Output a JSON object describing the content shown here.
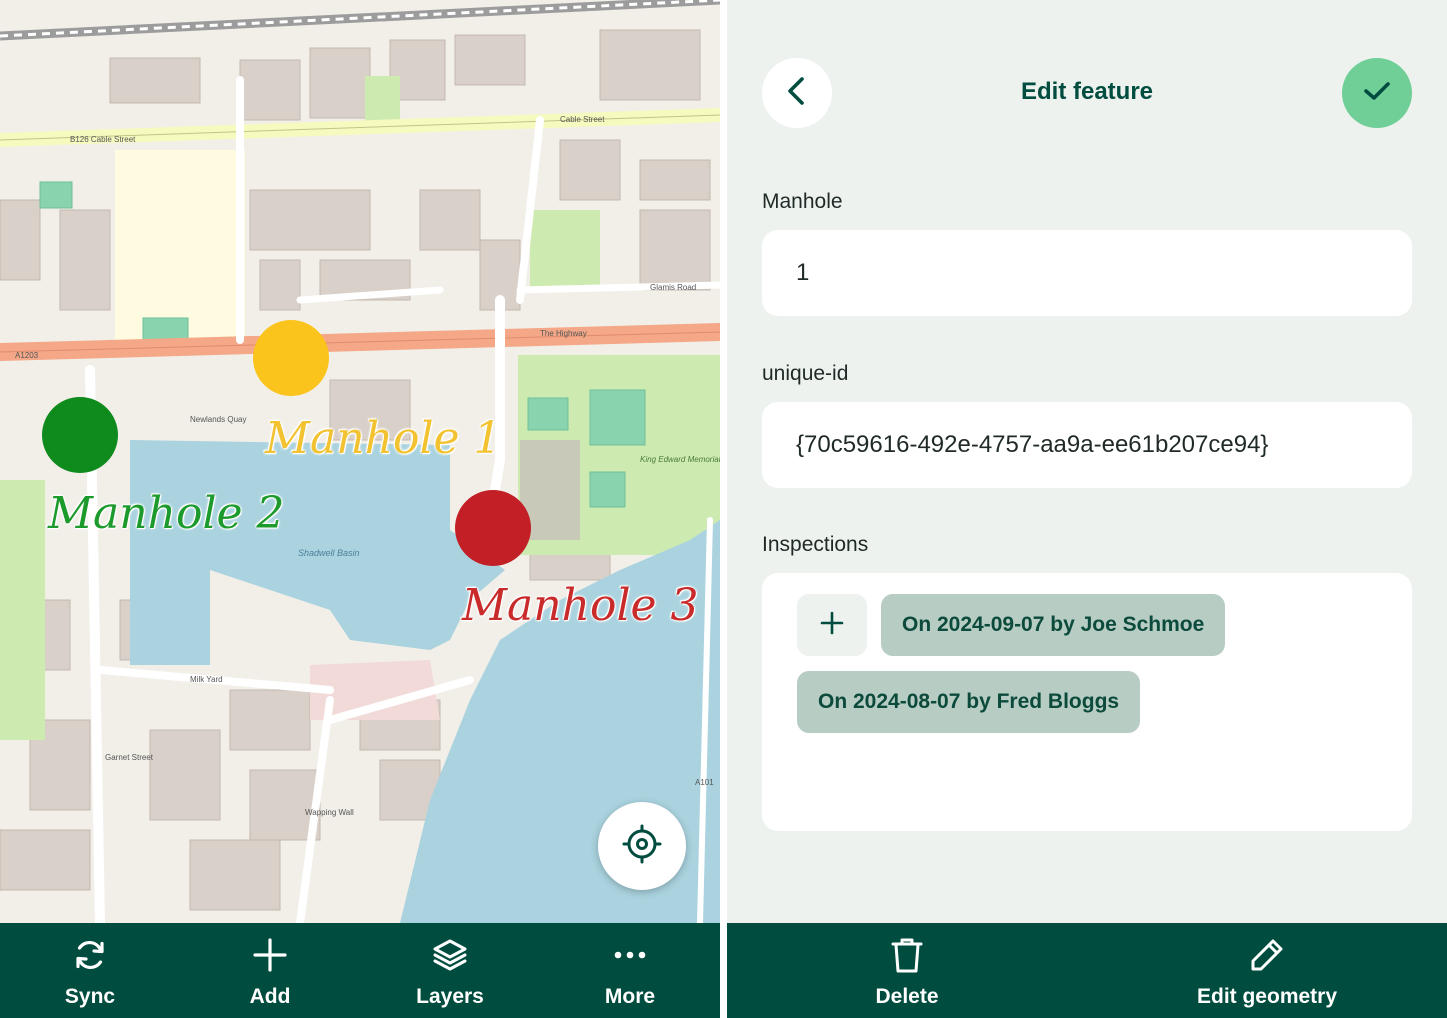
{
  "map": {
    "markers": [
      {
        "label": "Manhole 1",
        "color": "#fbc41c",
        "label_color": "#f2c230"
      },
      {
        "label": "Manhole 2",
        "color": "#0f8a1d",
        "label_color": "#1c9a2b"
      },
      {
        "label": "Manhole 3",
        "color": "#c22026",
        "label_color": "#c92a2a"
      }
    ],
    "map_labels": {
      "water_basin": "Shadwell Basin",
      "park": "King Edward Memorial Park",
      "road_highway": "The Highway",
      "road_cable": "Cable Street",
      "a1203": "A1203",
      "b126": "B126 Cable Street",
      "wapping_wall": "Wapping Wall",
      "glamis_road": "Glamis Road",
      "garnet_street": "Garnet Street",
      "milk_yard": "Milk Yard",
      "newlands_quay": "Newlands Quay",
      "a101": "A101"
    },
    "locate_icon": "crosshair-location-icon",
    "toolbar": [
      {
        "label": "Sync",
        "icon": "sync-icon"
      },
      {
        "label": "Add",
        "icon": "plus-icon"
      },
      {
        "label": "Layers",
        "icon": "layers-icon"
      },
      {
        "label": "More",
        "icon": "more-dots-icon"
      }
    ]
  },
  "form": {
    "title": "Edit feature",
    "fields": [
      {
        "label": "Manhole",
        "value": "1"
      },
      {
        "label": "unique-id",
        "value": "{70c59616-492e-4757-aa9a-ee61b207ce94}"
      }
    ],
    "inspections": {
      "label": "Inspections",
      "add_icon": "plus-icon",
      "items": [
        "On 2024-09-07 by Joe Schmoe",
        "On 2024-08-07 by Fred Bloggs"
      ]
    },
    "toolbar": [
      {
        "label": "Delete",
        "icon": "trash-icon"
      },
      {
        "label": "Edit geometry",
        "icon": "pencil-icon"
      }
    ]
  },
  "colors": {
    "primary_dark": "#004c3e",
    "confirm_green": "#6fcf97",
    "chip_bg": "#b7cdc3",
    "panel_bg": "#eef2ef"
  }
}
